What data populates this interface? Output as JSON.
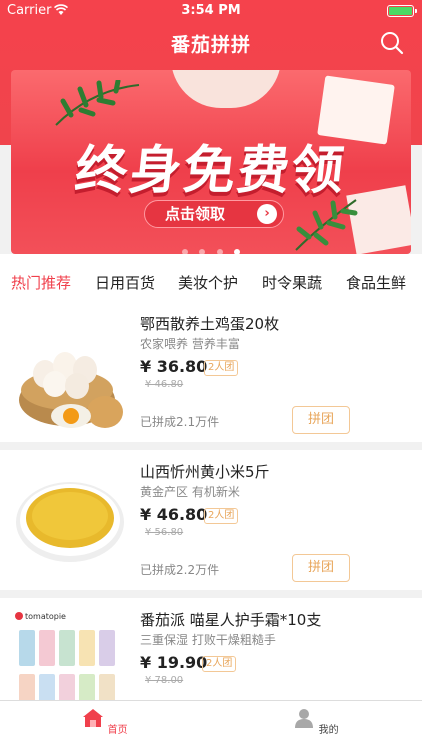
{
  "status_bar": {
    "carrier": "Carrier",
    "time": "3:54 PM"
  },
  "nav": {
    "title": "番茄拼拼",
    "search_icon": "search-icon"
  },
  "banner": {
    "headline": "终身免费领",
    "cta": "点击领取",
    "slide_count": 4,
    "active_slide": 4
  },
  "tabs": [
    "热门推荐",
    "日用百货",
    "美妆个护",
    "时令果蔬",
    "食品生鲜"
  ],
  "products": [
    {
      "title": "鄂西散养土鸡蛋20枚",
      "subtitle": "农家喂养  营养丰富",
      "price": "¥ 36.80",
      "group_badge": "2人团",
      "original_price": "¥ 46.80",
      "sold": "已拼成2.1万件",
      "button": "拼团"
    },
    {
      "title": "山西忻州黄小米5斤",
      "subtitle": "黄金产区 有机新米",
      "price": "¥ 46.80",
      "group_badge": "2人团",
      "original_price": "¥ 56.80",
      "sold": "已拼成2.2万件",
      "button": "拼团"
    },
    {
      "title": "番茄派 喵星人护手霜*10支",
      "subtitle": "三重保湿 打败干燥粗糙手",
      "price": "¥ 19.90",
      "group_badge": "2人团",
      "original_price": "¥ 78.00",
      "sold": "",
      "button": "",
      "brand_logo_text": "tomatopie"
    }
  ],
  "tabbar": {
    "home": "首页",
    "me": "我的"
  },
  "colors": {
    "brand_red": "#f0404c",
    "badge_orange": "#e8a65b"
  }
}
